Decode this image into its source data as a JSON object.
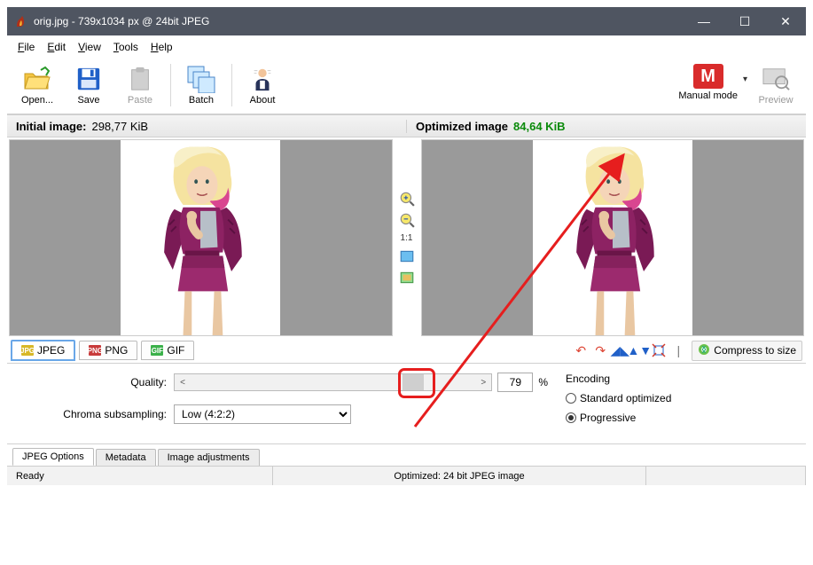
{
  "window": {
    "title": "orig.jpg - 739x1034 px @ 24bit JPEG",
    "minimize": "—",
    "maximize": "☐",
    "close": "✕"
  },
  "menu": {
    "file": "File",
    "edit": "Edit",
    "view": "View",
    "tools": "Tools",
    "help": "Help"
  },
  "toolbar": {
    "open": "Open...",
    "save": "Save",
    "paste": "Paste",
    "batch": "Batch",
    "about": "About",
    "mode": "Manual mode",
    "mode_letter": "M",
    "preview": "Preview"
  },
  "sizes": {
    "initial_label": "Initial image:",
    "initial_value": "298,77 KiB",
    "optimized_label": "Optimized image",
    "optimized_value": "84,64 KiB"
  },
  "preview_controls": {
    "ratio": "1:1"
  },
  "format_tabs": {
    "jpeg": "JPEG",
    "png": "PNG",
    "gif": "GIF"
  },
  "actions": {
    "compress": "Compress to size"
  },
  "options": {
    "quality_label": "Quality:",
    "quality_left": "<",
    "quality_right": ">",
    "quality_value": "79",
    "quality_pct": "%",
    "chroma_label": "Chroma subsampling:",
    "chroma_value": "Low (4:2:2)",
    "encoding_label": "Encoding",
    "enc_standard": "Standard optimized",
    "enc_progressive": "Progressive"
  },
  "bottom_tabs": {
    "jpeg_options": "JPEG Options",
    "metadata": "Metadata",
    "image_adjust": "Image adjustments"
  },
  "status": {
    "ready": "Ready",
    "mid": "Optimized: 24 bit JPEG image",
    "right": ""
  }
}
